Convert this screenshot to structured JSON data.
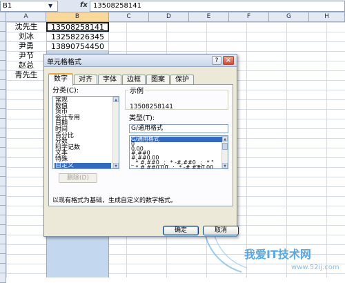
{
  "formula_bar": {
    "name_box": "B1",
    "fx_label": "fx",
    "formula_value": "13508258141"
  },
  "sheet": {
    "columns": [
      "A",
      "B",
      "C",
      "D",
      "E",
      "F",
      "G",
      "H"
    ],
    "selected_column": "B",
    "rows_visible": 27,
    "cells": [
      {
        "a": "沈先生",
        "b": "13508258141"
      },
      {
        "a": "刘冰",
        "b": "13258226345"
      },
      {
        "a": "尹勇",
        "b": "13890754450"
      },
      {
        "a": "尹节",
        "b": ""
      },
      {
        "a": "赵总",
        "b": ""
      },
      {
        "a": "青先生",
        "b": ""
      }
    ]
  },
  "dialog": {
    "title": "单元格格式",
    "help_label": "?",
    "close_label": "×",
    "tabs": [
      "数字",
      "对齐",
      "字体",
      "边框",
      "图案",
      "保护"
    ],
    "active_tab": 0,
    "category_label": "分类(C):",
    "categories": [
      "常规",
      "数值",
      "货币",
      "会计专用",
      "日期",
      "时间",
      "百分比",
      "分数",
      "科学记数",
      "文本",
      "特殊",
      "自定义"
    ],
    "selected_category": 11,
    "sample_label": "示例",
    "sample_value": "13508258141",
    "type_label": "类型(T):",
    "type_value": "G/通用格式",
    "formats": [
      "G/通用格式",
      "0",
      "0.00",
      "#,##0",
      "#,##0.00",
      "_ * #,##0_ ;_ * -#,##0_ ;_ * \"",
      "_ * #,##0.00_ ;_ * -#,##0.00_"
    ],
    "selected_format": 0,
    "delete_button": "删除(D)",
    "description": "以现有格式为基础，生成自定义的数字格式。",
    "ok_button": "确定",
    "cancel_button": "取消"
  },
  "watermark": {
    "brand": "我爱IT技术网",
    "url": "www.52ij.com"
  }
}
